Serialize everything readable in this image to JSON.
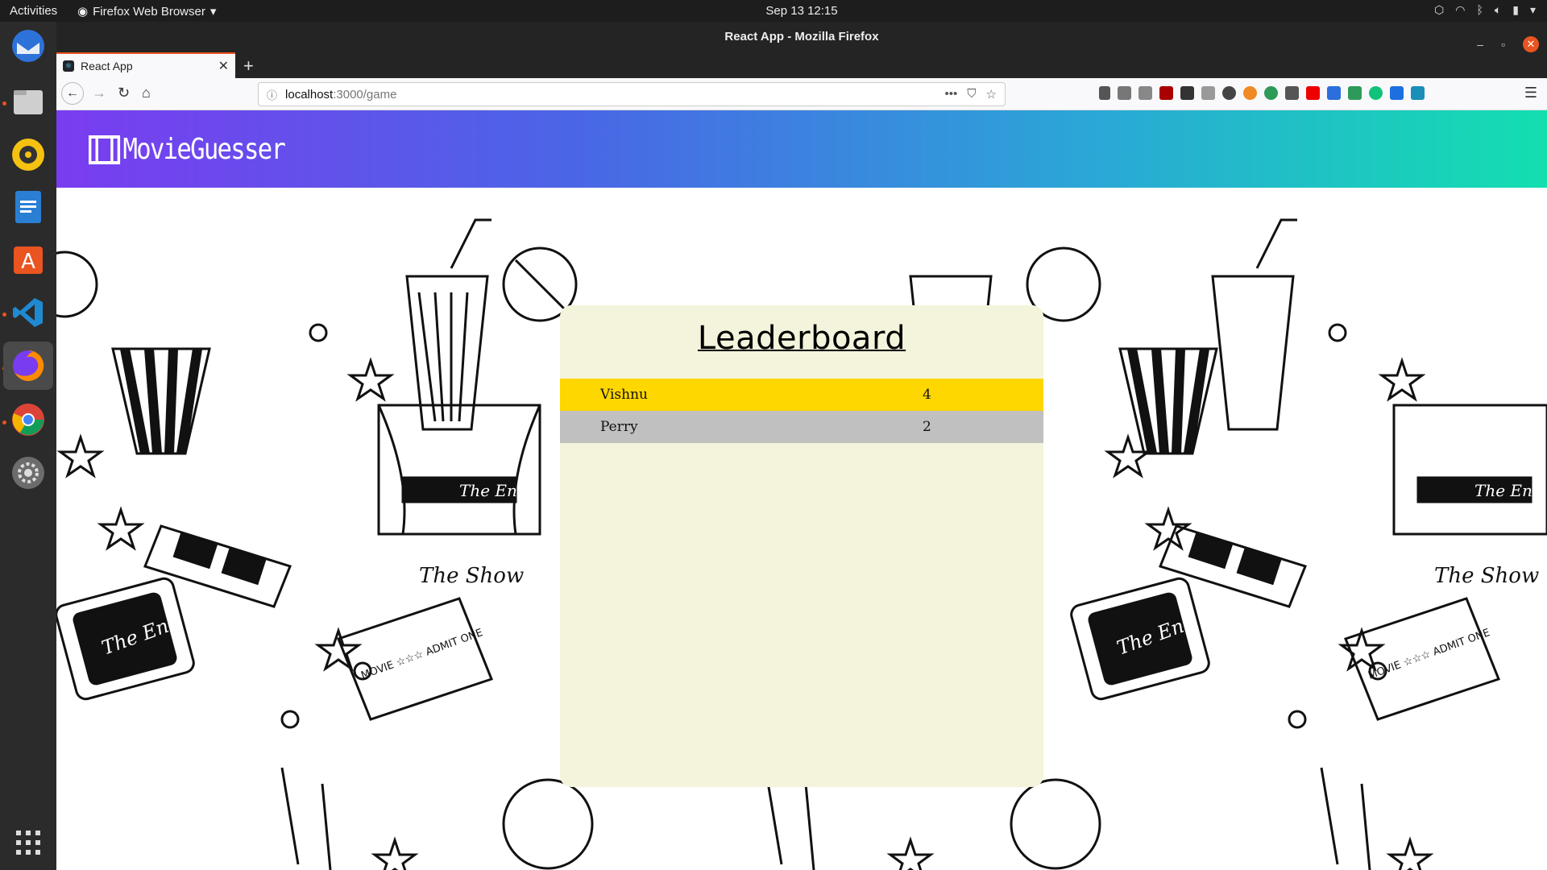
{
  "topbar": {
    "activities": "Activities",
    "app_menu": "Firefox Web Browser",
    "clock": "Sep 13  12:15"
  },
  "dock": {
    "items": [
      "thunderbird-icon",
      "files-icon",
      "rhythmbox-icon",
      "writer-icon",
      "software-icon",
      "vscode-icon",
      "firefox-icon",
      "chrome-icon",
      "settings-icon"
    ],
    "apps_grid": "show-applications-icon"
  },
  "window": {
    "title": "React App - Mozilla Firefox"
  },
  "tab": {
    "title": "React App"
  },
  "url": {
    "host": "localhost",
    "path": ":3000/game"
  },
  "app": {
    "logo_text": "MovieGuesser",
    "header_gradient": [
      "#7a3cf0",
      "#13dfb0"
    ]
  },
  "leaderboard": {
    "title": "Leaderboard",
    "rows": [
      {
        "name": "Vishnu",
        "score": "4",
        "color": "#ffd700"
      },
      {
        "name": "Perry",
        "score": "2",
        "color": "#c0c0c0"
      }
    ]
  },
  "doodles": {
    "the_end": "The End",
    "the_show": "The Show",
    "ticket": "MOVIE ☆☆☆ ADMIT ONE"
  }
}
